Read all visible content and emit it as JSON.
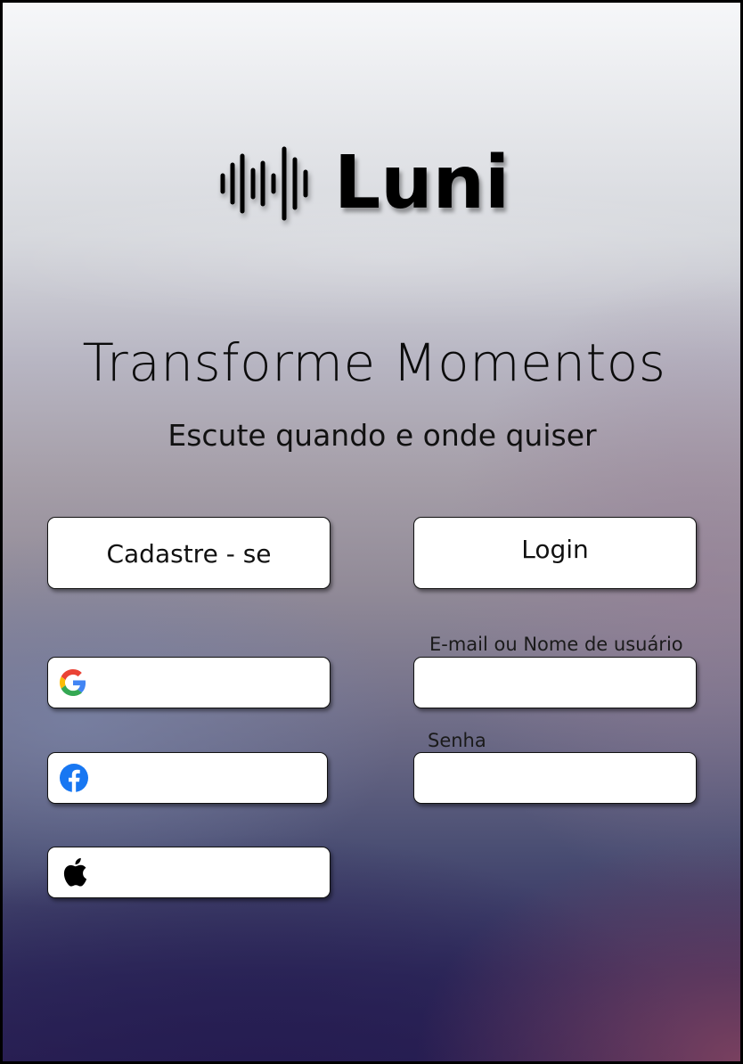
{
  "brand": {
    "name": "Luni",
    "logo_icon": "sound-wave-icon"
  },
  "hero": {
    "headline": "Transforme Momentos",
    "subheadline": "Escute quando e onde quiser"
  },
  "actions": {
    "signup_label": "Cadastre - se",
    "login_label": "Login"
  },
  "social": [
    {
      "provider": "google",
      "icon": "google-icon"
    },
    {
      "provider": "facebook",
      "icon": "facebook-icon"
    },
    {
      "provider": "apple",
      "icon": "apple-icon"
    }
  ],
  "login_form": {
    "username_label": "E-mail ou Nome de usuário",
    "username_value": "",
    "password_label": "Senha",
    "password_value": ""
  },
  "colors": {
    "google_blue": "#4285F4",
    "google_red": "#EA4335",
    "google_yellow": "#FBBC05",
    "google_green": "#34A853",
    "facebook_blue": "#1877F2"
  }
}
